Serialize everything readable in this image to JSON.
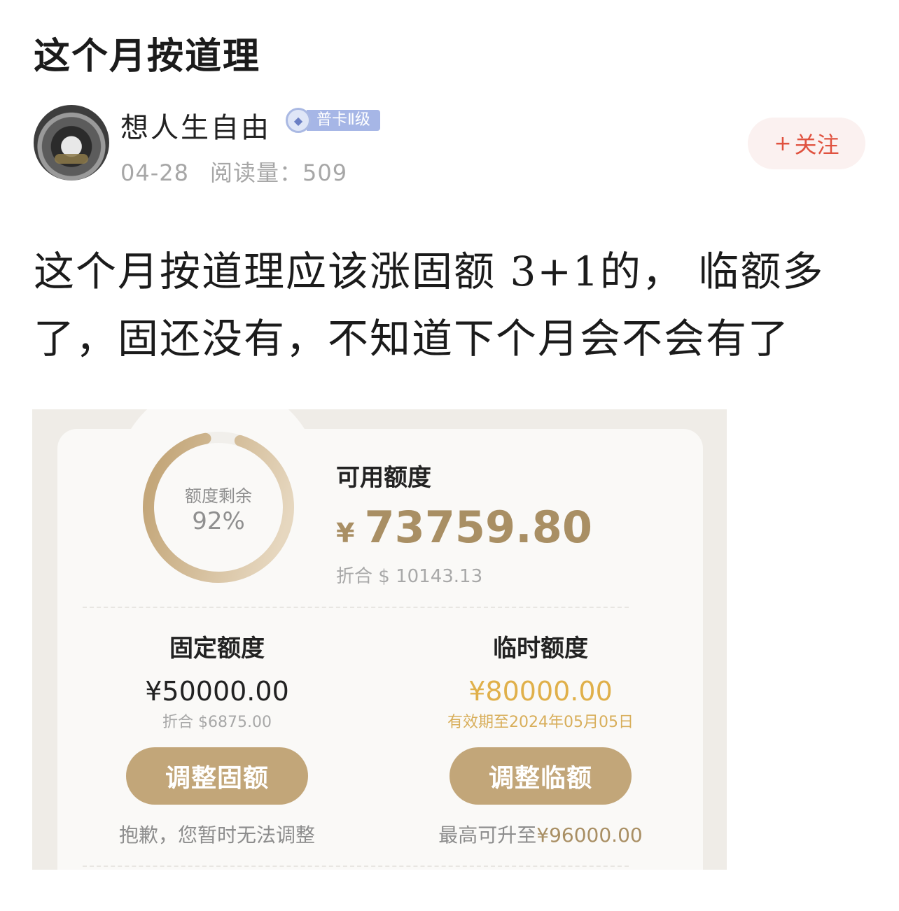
{
  "post": {
    "title": "这个月按道理",
    "body_part1": "这个月按道理应该涨固额 ",
    "body_formula": "3+1",
    "body_part2": "的， 临额多了，固还没有，不知道下个月会不会有了"
  },
  "author": {
    "name": "想人生自由",
    "badge_label": "普卡Ⅱ级",
    "date": "04-28",
    "reads_label": "阅读量：",
    "reads_value": "509",
    "follow_plus": "+",
    "follow_label": "关注"
  },
  "credit": {
    "ring_caption": "额度剩余",
    "ring_percent": "92%",
    "ring_fraction": 0.92,
    "available_title": "可用额度",
    "available_currency": "¥",
    "available_amount": "73759.80",
    "available_usd": "折合 $ 10143.13",
    "fixed": {
      "title": "固定额度",
      "amount": "¥50000.00",
      "sub": "折合 $6875.00",
      "button": "调整固额",
      "note": "抱歉，您暂时无法调整"
    },
    "temporary": {
      "title": "临时额度",
      "amount": "¥80000.00",
      "sub": "有效期至2024年05月05日",
      "button": "调整临额",
      "note_prefix": "最高可升至",
      "note_value": "¥96000.00"
    }
  },
  "colors": {
    "accent_gold": "#c2a679",
    "amount_gold": "#a98f64",
    "temp_gold": "#e0b04a",
    "follow_red": "#e0523f",
    "badge_blue": "#a6b6e6"
  }
}
